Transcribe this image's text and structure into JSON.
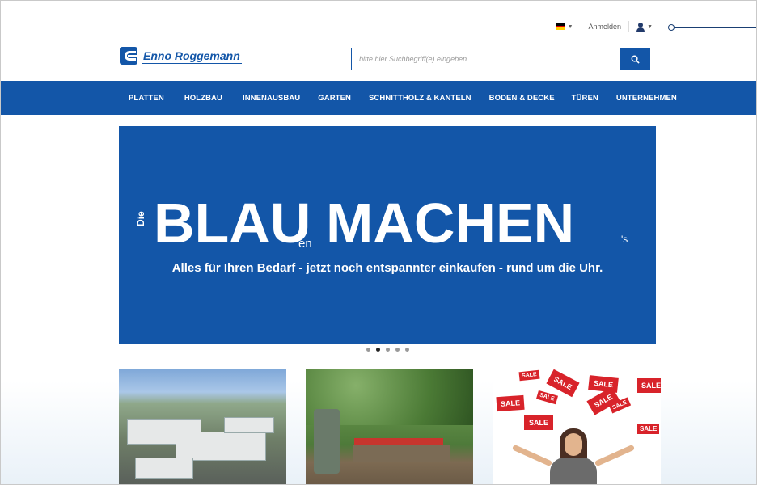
{
  "header": {
    "language": {
      "flag": [
        "#000000",
        "#dd0000",
        "#ffce00"
      ]
    },
    "login_label": "Anmelden"
  },
  "logo": {
    "text": "Enno Roggemann"
  },
  "search": {
    "placeholder": "bitte hier Suchbegriff(e) eingeben"
  },
  "nav": {
    "items": [
      "PLATTEN",
      "HOLZBAU",
      "INNENAUSBAU",
      "GARTEN",
      "SCHNITTHOLZ & KANTELN",
      "BODEN & DECKE",
      "TÜREN",
      "UNTERNEHMEN"
    ]
  },
  "hero": {
    "die": "Die",
    "word1": "BLAU",
    "suffix1": "en",
    "word2": "MACHEN",
    "suffix2": "'s",
    "subline": "Alles für Ihren Bedarf - jetzt noch entspannter einkaufen - rund um die Uhr.",
    "background": "#1356a8"
  },
  "carousel": {
    "slide_count": 5,
    "active_index": 1
  },
  "tiles": [
    {
      "name": "company-aerial-photo"
    },
    {
      "name": "garden-photo"
    },
    {
      "name": "sale-promo-photo",
      "tags": [
        "SALE",
        "SALE",
        "SALE",
        "SALE",
        "SALE",
        "SALE",
        "SALE",
        "SALE",
        "SALE",
        "SALE"
      ]
    }
  ],
  "colors": {
    "brand": "#1356a8",
    "sale": "#d8232a"
  }
}
